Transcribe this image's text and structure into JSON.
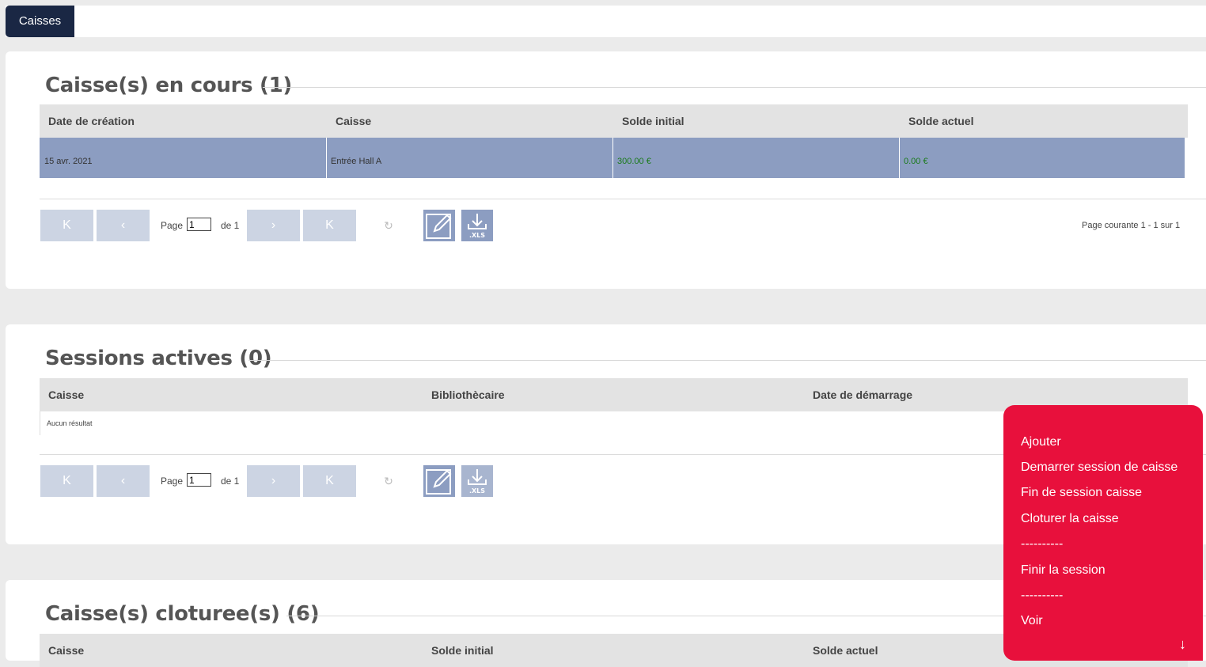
{
  "tabs": {
    "active": "Caisses"
  },
  "panel1": {
    "title": "Caisse(s) en cours (1)",
    "columns": [
      "Date de création",
      "Caisse",
      "Solde initial",
      "Solde actuel"
    ],
    "rows": [
      {
        "date": "15 avr. 2021",
        "caisse": "Entrée Hall A",
        "solde_initial": "300.00 €",
        "solde_actuel": "0.00 €"
      }
    ],
    "pager": {
      "page_label": "Page",
      "page_value": "1",
      "of_label": "de 1",
      "info": "Page courante 1 - 1 sur 1"
    }
  },
  "panel2": {
    "title": "Sessions actives (0)",
    "columns": [
      "Caisse",
      "Bibliothècaire",
      "Date de démarrage"
    ],
    "empty": "Aucun résultat",
    "pager": {
      "page_label": "Page",
      "page_value": "1",
      "of_label": "de 1"
    }
  },
  "panel3": {
    "title": "Caisse(s) cloturee(s) (6)",
    "columns": [
      "Caisse",
      "Solde initial",
      "Solde actuel"
    ]
  },
  "menu": {
    "items": [
      "Ajouter",
      "Demarrer session de caisse",
      "Fin de session caisse",
      "Cloturer la caisse",
      "----------",
      "Finir la session",
      "----------",
      "Voir"
    ]
  },
  "icons": {
    "first": "first-page-icon",
    "prev": "prev-page-icon",
    "next": "next-page-icon",
    "last": "last-page-icon",
    "refresh": "refresh-icon",
    "edit": "edit-icon",
    "export": "xls-export-icon",
    "scroll": "arrow-down-icon"
  },
  "colors": {
    "accent": "#e8103c",
    "tab": "#1a2744",
    "selected_row": "#8c9dc1",
    "money": "#1a7a1a"
  },
  "export_label": ".XLS"
}
